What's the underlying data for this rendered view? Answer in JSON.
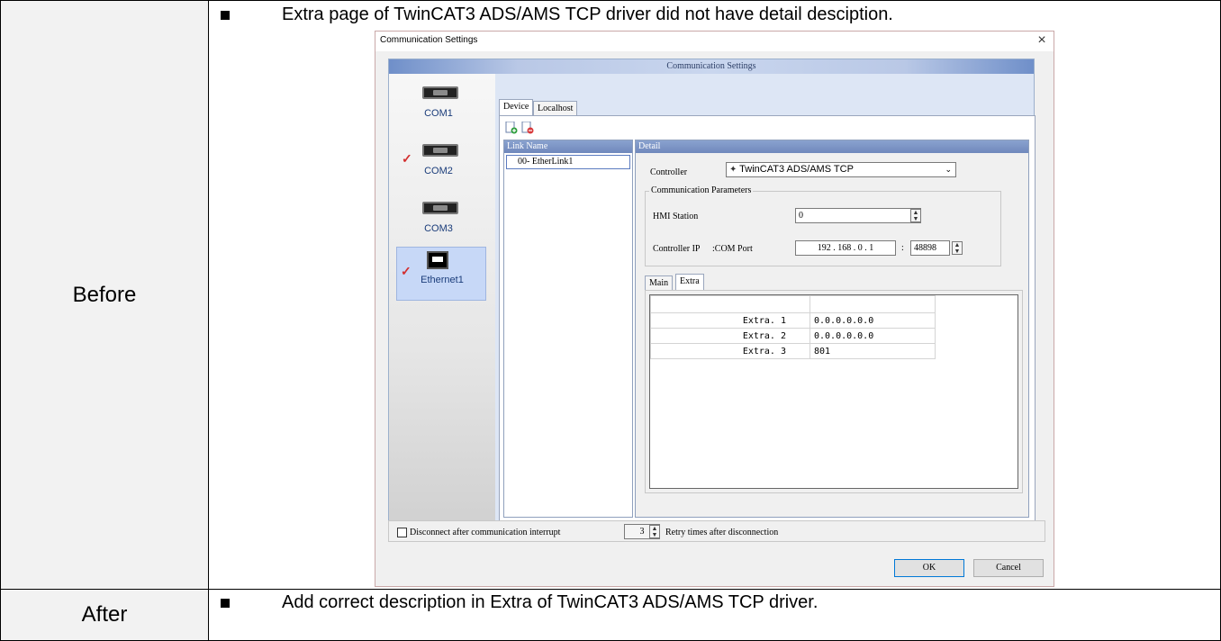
{
  "rows": {
    "before_label": "Before",
    "after_label": "After"
  },
  "before_text": "Extra page of TwinCAT3 ADS/AMS TCP driver did not have detail desciption.",
  "after_text": "Add correct description in Extra of TwinCAT3 ADS/AMS TCP driver.",
  "dialog": {
    "window_title": "Communication Settings",
    "close_glyph": "×",
    "header": "Communication Settings",
    "ports": [
      {
        "label": "COM1",
        "checked": false
      },
      {
        "label": "COM2",
        "checked": true
      },
      {
        "label": "COM3",
        "checked": false
      },
      {
        "label": "Ethernet1",
        "checked": true
      }
    ],
    "checkmark": "✓",
    "tabs": [
      "Device",
      "Localhost"
    ],
    "link_name_header": "Link Name",
    "link_items": [
      "00- EtherLink1"
    ],
    "detail_header": "Detail",
    "controller_label": "Controller",
    "controller_value": "TwinCAT3 ADS/AMS TCP",
    "comm_params_label": "Communication Parameters",
    "hmi_station_label": "HMI Station",
    "hmi_station_value": "0",
    "controller_ip_label": "Controller IP",
    "com_port_label": ":COM Port",
    "ip_value": "192 . 168 .  0  .  1",
    "colon": ":",
    "port_value": "48898",
    "sub_tabs": [
      "Main",
      "Extra"
    ],
    "extra_rows": [
      {
        "name": "Extra. 1",
        "value": "0.0.0.0.0.0"
      },
      {
        "name": "Extra. 2",
        "value": "0.0.0.0.0.0"
      },
      {
        "name": "Extra. 3",
        "value": "801"
      }
    ],
    "disconnect_label": "Disconnect after communication interrupt",
    "retry_value": "3",
    "retry_label": "Retry times after disconnection",
    "ok_label": "OK",
    "cancel_label": "Cancel"
  },
  "icons": [
    "serial-port-icon",
    "ethernet-port-icon",
    "checkmark-icon",
    "add-link-icon",
    "delete-link-icon",
    "dropdown-chevron-icon",
    "spin-arrows-icon",
    "close-icon",
    "bullet-icon"
  ]
}
